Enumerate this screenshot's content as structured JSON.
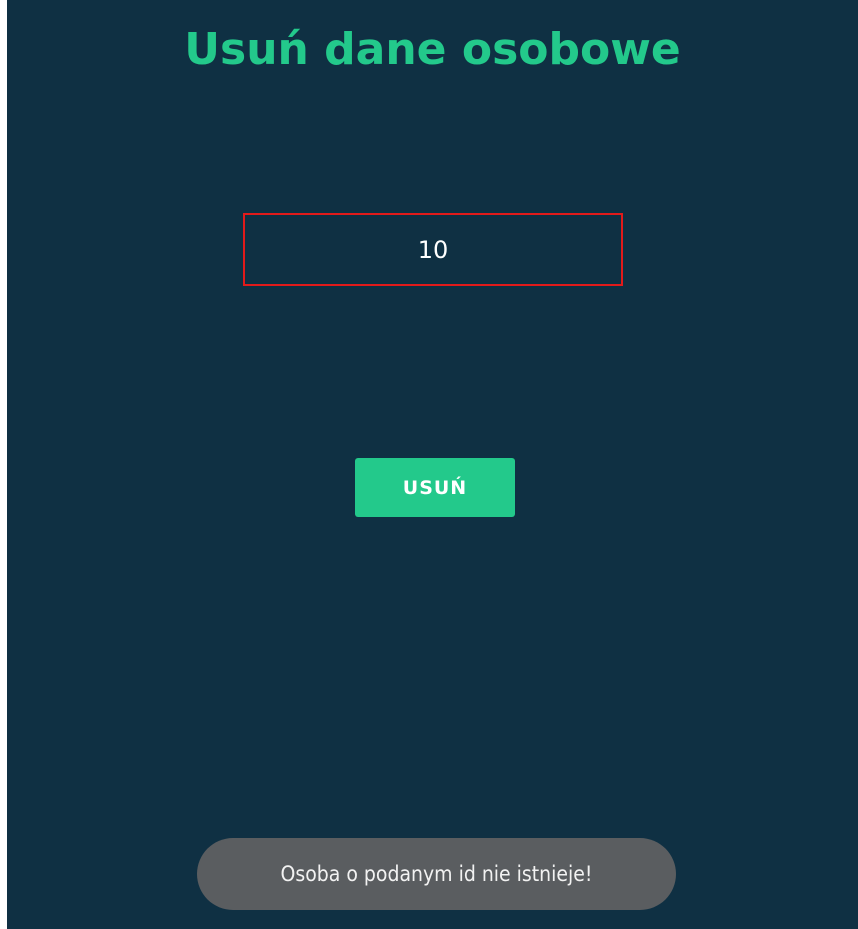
{
  "screen": {
    "title": "Usuń dane osobowe",
    "id_field": {
      "value": "10"
    },
    "delete_button": {
      "label": "USUŃ"
    },
    "toast": {
      "message": "Osoba o podanym id nie istnieje!"
    }
  },
  "colors": {
    "background": "#0f3043",
    "accent": "#23c98b",
    "field_border": "#e21a1a",
    "toast_background": "#5a5d60"
  }
}
